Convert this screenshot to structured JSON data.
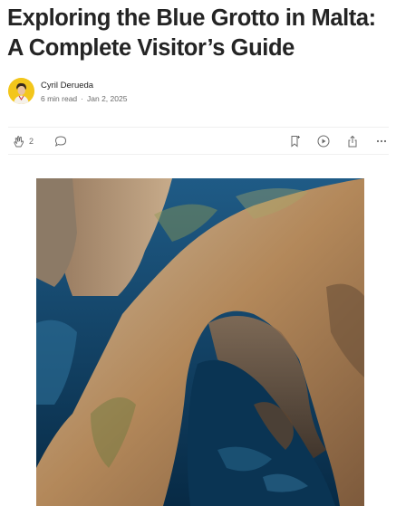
{
  "article": {
    "title_line1": "Exploring the Blue Grotto in Malta:",
    "title_line2": "A Complete Visitor’s Guide"
  },
  "author": {
    "name": "Cyril Derueda",
    "read_time": "6 min read",
    "separator": "·",
    "date": "Jan 2, 2025"
  },
  "actions": {
    "clap_count": "2",
    "icons": [
      "clap-icon",
      "comment-icon",
      "bookmark-icon",
      "play-icon",
      "share-icon",
      "more-icon"
    ]
  },
  "colors": {
    "text": "#242424",
    "muted": "#6b6b6b",
    "avatar_bg": "#f3c61b"
  }
}
